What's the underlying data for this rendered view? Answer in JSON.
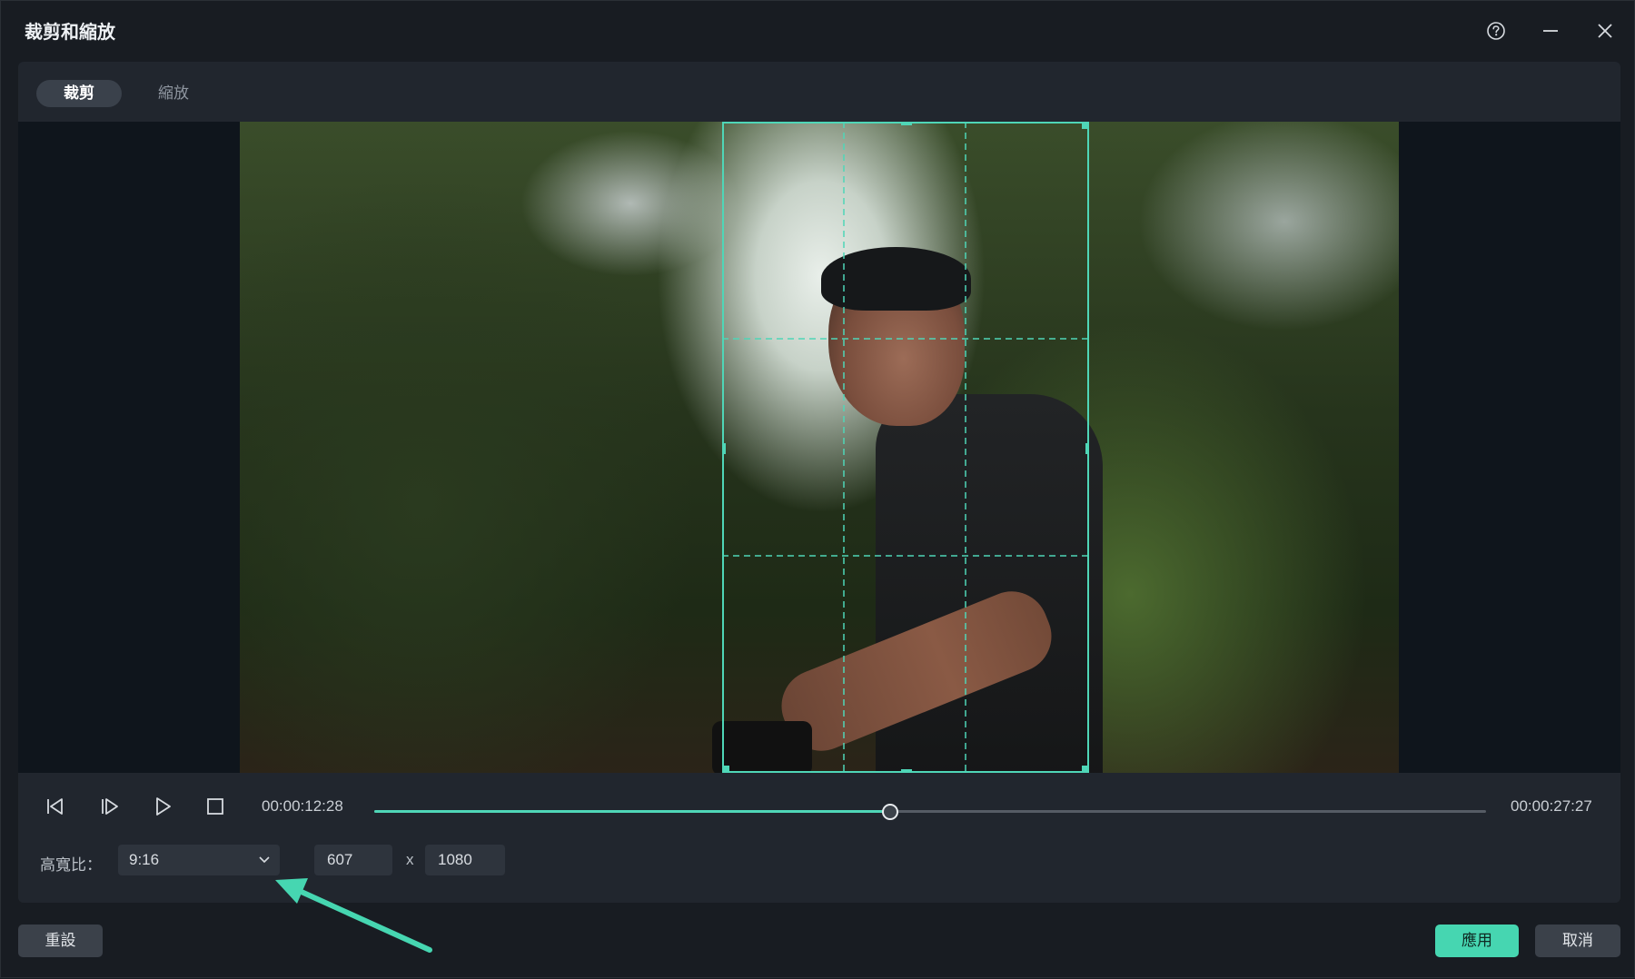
{
  "window": {
    "title": "裁剪和縮放"
  },
  "tabs": [
    {
      "label": "裁剪",
      "active": true
    },
    {
      "label": "縮放",
      "active": false
    }
  ],
  "playback": {
    "current_time": "00:00:12:28",
    "total_time": "00:00:27:27",
    "progress": 0.463
  },
  "crop": {
    "ratio_label": "高寬比：",
    "ratio_value": "9:16",
    "width": "607",
    "separator": "x",
    "height": "1080"
  },
  "footer": {
    "reset_label": "重設",
    "apply_label": "應用",
    "cancel_label": "取消"
  },
  "colors": {
    "accent": "#46d6b1",
    "background": "#181c22",
    "panel": "#21262e"
  },
  "icons": {
    "help": "help-icon",
    "minimize": "minimize-icon",
    "close": "close-icon",
    "prev_frame": "prev-frame-icon",
    "next_frame": "next-frame-icon",
    "play": "play-icon",
    "stop": "stop-icon",
    "dropdown": "chevron-down-icon"
  }
}
